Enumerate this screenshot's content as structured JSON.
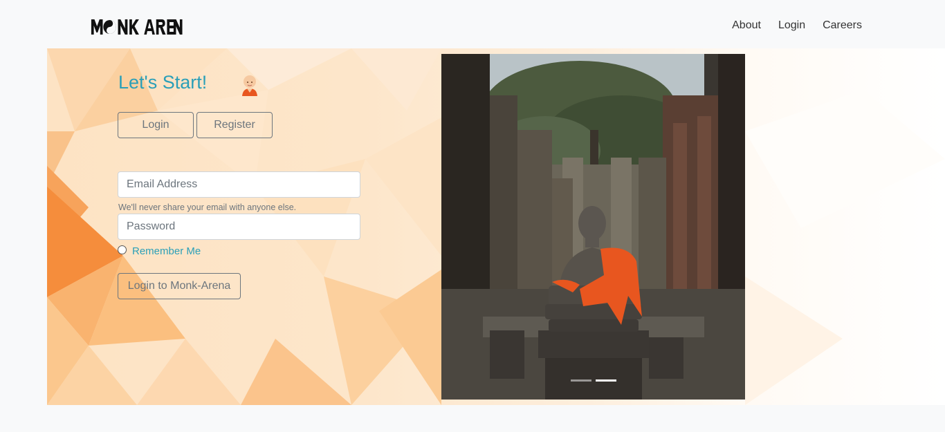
{
  "navbar": {
    "brand": "MONK ARENA",
    "links": [
      "About",
      "Login",
      "Careers"
    ]
  },
  "form": {
    "title": "Let's Start!",
    "tabs": {
      "login": "Login",
      "register": "Register"
    },
    "email": {
      "placeholder": "Email Address",
      "help": "We'll never share your email with anyone else."
    },
    "password": {
      "placeholder": "Password"
    },
    "remember": "Remember Me",
    "submit": "Login to Monk-Arena"
  },
  "carousel": {
    "slide_count": 2,
    "active_index": 1
  },
  "colors": {
    "accent": "#2a9fb8",
    "secondary": "#6c757d",
    "background": "#f8f9fa",
    "robe": "#e8561f"
  }
}
